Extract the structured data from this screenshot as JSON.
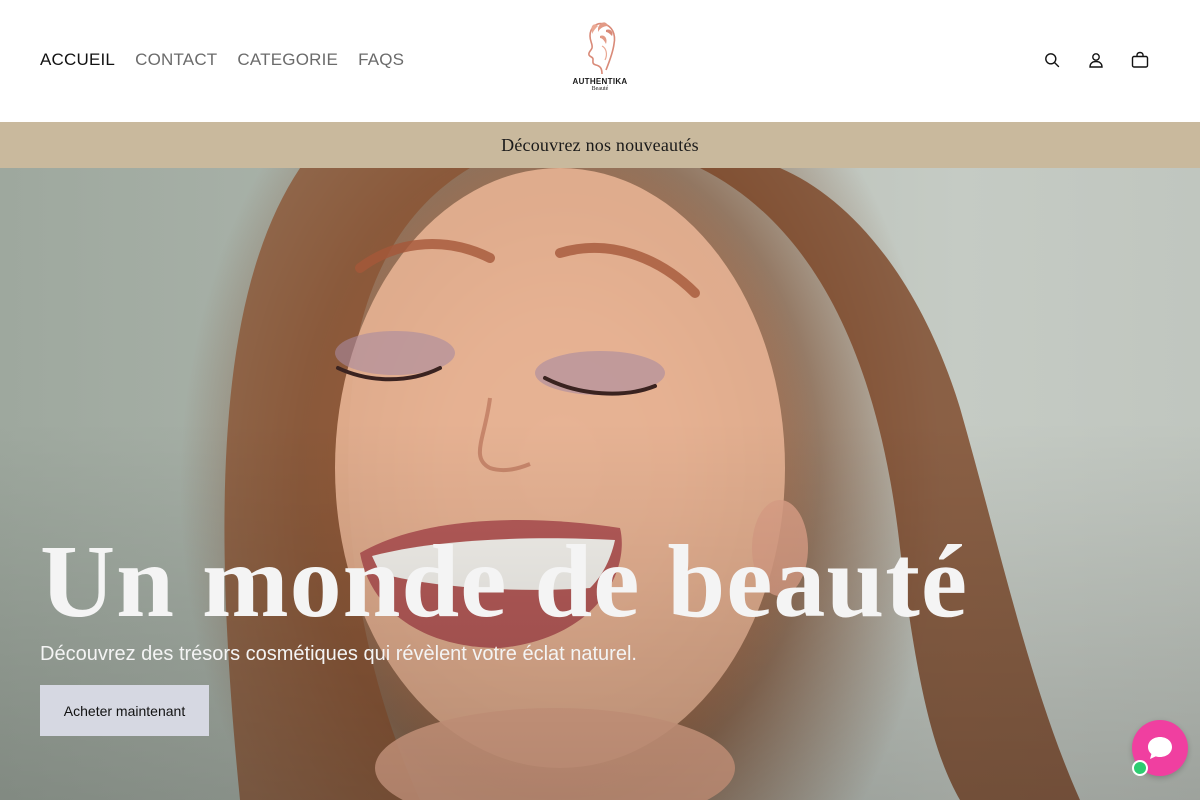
{
  "header": {
    "nav": [
      {
        "label": "ACCUEIL",
        "active": true
      },
      {
        "label": "CONTACT",
        "active": false
      },
      {
        "label": "CATEGORIE",
        "active": false
      },
      {
        "label": "FAQS",
        "active": false
      }
    ],
    "logo": {
      "brand": "AUTHENTIKA",
      "sub": "Beauté"
    },
    "icons": [
      "search-icon",
      "account-icon",
      "cart-icon"
    ]
  },
  "announcement": {
    "text": "Découvrez nos nouveautés",
    "background": "#c9b99d"
  },
  "hero": {
    "title": "Un monde de beauté",
    "subtitle": "Découvrez des trésors cosmétiques qui révèlent votre éclat naturel.",
    "button_label": "Acheter maintenant"
  },
  "chat": {
    "icon": "chat-bubble-icon",
    "color": "#f03fa0",
    "status_color": "#2ecc71"
  }
}
